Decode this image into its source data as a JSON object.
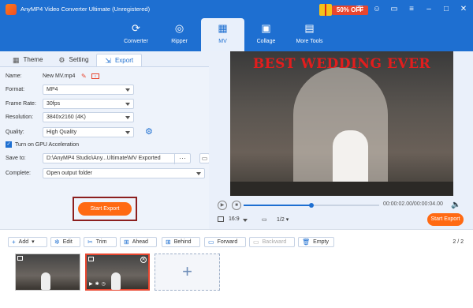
{
  "app": {
    "title": "AnyMP4 Video Converter Ultimate (Unregistered)",
    "promo": "50% OFF"
  },
  "nav": {
    "tabs": [
      {
        "label": "Converter",
        "icon": "converter-icon"
      },
      {
        "label": "Ripper",
        "icon": "disc-icon"
      },
      {
        "label": "MV",
        "icon": "mv-icon",
        "active": true
      },
      {
        "label": "Collage",
        "icon": "collage-icon"
      },
      {
        "label": "More Tools",
        "icon": "toolbox-icon"
      }
    ]
  },
  "subtabs": [
    {
      "label": "Theme",
      "icon": "grid-icon"
    },
    {
      "label": "Setting",
      "icon": "gear-icon"
    },
    {
      "label": "Export",
      "icon": "export-icon",
      "active": true
    }
  ],
  "form": {
    "name_label": "Name:",
    "name_value": "New MV.mp4",
    "format_label": "Format:",
    "format_value": "MP4",
    "frame_rate_label": "Frame Rate:",
    "frame_rate_value": "30fps",
    "resolution_label": "Resolution:",
    "resolution_value": "3840x2160 (4K)",
    "quality_label": "Quality:",
    "quality_value": "High Quality",
    "gpu_label": "Turn on GPU Acceleration",
    "gpu_checked": true,
    "save_to_label": "Save to:",
    "save_to_value": "D:\\AnyMP4 Studio\\Any...Ultimate\\MV Exported",
    "save_to_more": "···",
    "complete_label": "Complete:",
    "complete_value": "Open output folder",
    "start_export": "Start Export"
  },
  "preview": {
    "video_title": "BEST WEDDING EVER",
    "time": "00:00:02.00/00:00:04.00",
    "progress": 0.5,
    "aspect_ratio": "16:9",
    "screens": "1/2",
    "start_export": "Start Export"
  },
  "toolbar": {
    "add": "Add",
    "edit": "Edit",
    "trim": "Trim",
    "ahead": "Ahead",
    "behind": "Behind",
    "forward": "Forward",
    "backward": "Backward",
    "empty": "Empty",
    "page_count": "2 / 2"
  },
  "timeline": {
    "clips": 2,
    "add_symbol": "+"
  },
  "colors": {
    "brand_blue": "#1e6fd1",
    "accent_orange": "#ff6a13",
    "title_red": "#e21d1d"
  }
}
